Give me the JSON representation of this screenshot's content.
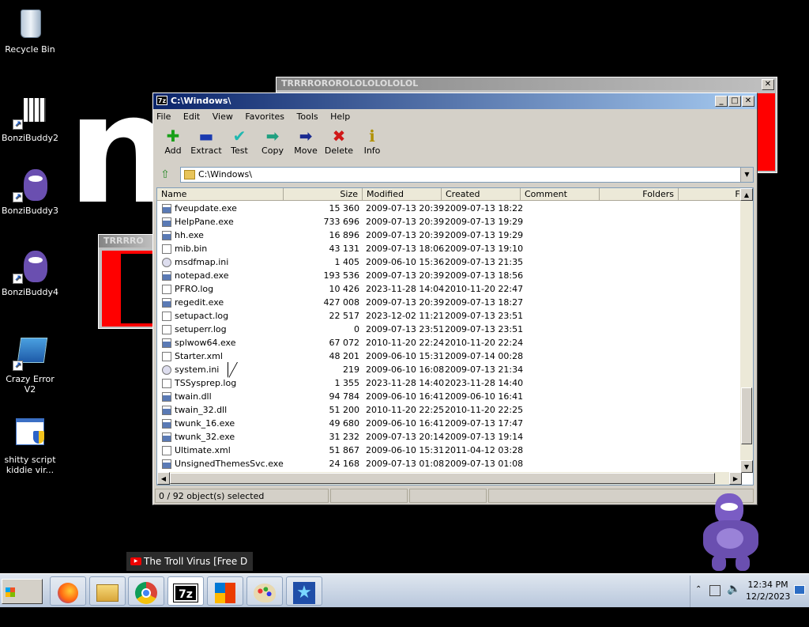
{
  "desktop": {
    "icons": [
      {
        "label": "Recycle Bin"
      },
      {
        "label": "BonziBuddy2"
      },
      {
        "label": "BonziBuddy3"
      },
      {
        "label": "BonziBuddy4"
      },
      {
        "label": "Crazy Error V2"
      },
      {
        "label": "shitty script kiddie vir..."
      }
    ],
    "big_letter": "n"
  },
  "bg_window_1": {
    "title": "TRRRROROROLOLOLOLOLOL"
  },
  "bg_window_2": {
    "title": "TRRRRO"
  },
  "window": {
    "title": "C:\\Windows\\",
    "menu": [
      "File",
      "Edit",
      "View",
      "Favorites",
      "Tools",
      "Help"
    ],
    "toolbar": [
      {
        "label": "Add",
        "icon": "plus-icon",
        "glyph": "✚",
        "color": "#18a018"
      },
      {
        "label": "Extract",
        "icon": "minus-icon",
        "glyph": "▬",
        "color": "#1a3ab0"
      },
      {
        "label": "Test",
        "icon": "check-icon",
        "glyph": "✔",
        "color": "#20b8b0"
      },
      {
        "label": "Copy",
        "icon": "arrow-right-icon",
        "glyph": "➡",
        "color": "#20a080"
      },
      {
        "label": "Move",
        "icon": "arrow-right-icon",
        "glyph": "➡",
        "color": "#1a2a90"
      },
      {
        "label": "Delete",
        "icon": "x-icon",
        "glyph": "✖",
        "color": "#d01818"
      },
      {
        "label": "Info",
        "icon": "info-icon",
        "glyph": "ℹ",
        "color": "#b09000"
      }
    ],
    "address": "C:\\Windows\\",
    "columns": [
      "Name",
      "Size",
      "Modified",
      "Created",
      "Comment",
      "Folders",
      "Fi"
    ],
    "rows": [
      {
        "name": "fveupdate.exe",
        "size": "15 360",
        "modified": "2009-07-13 20:39",
        "created": "2009-07-13 18:22",
        "type": "exe"
      },
      {
        "name": "HelpPane.exe",
        "size": "733 696",
        "modified": "2009-07-13 20:39",
        "created": "2009-07-13 19:29",
        "type": "exe"
      },
      {
        "name": "hh.exe",
        "size": "16 896",
        "modified": "2009-07-13 20:39",
        "created": "2009-07-13 19:29",
        "type": "exe"
      },
      {
        "name": "mib.bin",
        "size": "43 131",
        "modified": "2009-07-13 18:06",
        "created": "2009-07-13 19:10",
        "type": "file"
      },
      {
        "name": "msdfmap.ini",
        "size": "1 405",
        "modified": "2009-06-10 15:36",
        "created": "2009-07-13 21:35",
        "type": "ini"
      },
      {
        "name": "notepad.exe",
        "size": "193 536",
        "modified": "2009-07-13 20:39",
        "created": "2009-07-13 18:56",
        "type": "exe"
      },
      {
        "name": "PFRO.log",
        "size": "10 426",
        "modified": "2023-11-28 14:04",
        "created": "2010-11-20 22:47",
        "type": "file"
      },
      {
        "name": "regedit.exe",
        "size": "427 008",
        "modified": "2009-07-13 20:39",
        "created": "2009-07-13 18:27",
        "type": "exe"
      },
      {
        "name": "setupact.log",
        "size": "22 517",
        "modified": "2023-12-02 11:21",
        "created": "2009-07-13 23:51",
        "type": "file"
      },
      {
        "name": "setuperr.log",
        "size": "0",
        "modified": "2009-07-13 23:51",
        "created": "2009-07-13 23:51",
        "type": "file"
      },
      {
        "name": "splwow64.exe",
        "size": "67 072",
        "modified": "2010-11-20 22:24",
        "created": "2010-11-20 22:24",
        "type": "exe"
      },
      {
        "name": "Starter.xml",
        "size": "48 201",
        "modified": "2009-06-10 15:31",
        "created": "2009-07-14 00:28",
        "type": "file"
      },
      {
        "name": "system.ini",
        "size": "219",
        "modified": "2009-06-10 16:08",
        "created": "2009-07-13 21:34",
        "type": "ini"
      },
      {
        "name": "TSSysprep.log",
        "size": "1 355",
        "modified": "2023-11-28 14:40",
        "created": "2023-11-28 14:40",
        "type": "file"
      },
      {
        "name": "twain.dll",
        "size": "94 784",
        "modified": "2009-06-10 16:41",
        "created": "2009-06-10 16:41",
        "type": "exe"
      },
      {
        "name": "twain_32.dll",
        "size": "51 200",
        "modified": "2010-11-20 22:25",
        "created": "2010-11-20 22:25",
        "type": "exe"
      },
      {
        "name": "twunk_16.exe",
        "size": "49 680",
        "modified": "2009-06-10 16:41",
        "created": "2009-07-13 17:47",
        "type": "exe"
      },
      {
        "name": "twunk_32.exe",
        "size": "31 232",
        "modified": "2009-07-13 20:14",
        "created": "2009-07-13 19:14",
        "type": "exe"
      },
      {
        "name": "Ultimate.xml",
        "size": "51 867",
        "modified": "2009-06-10 15:31",
        "created": "2011-04-12 03:28",
        "type": "file"
      },
      {
        "name": "UnsignedThemesSvc.exe",
        "size": "24 168",
        "modified": "2009-07-13 01:08",
        "created": "2009-07-13 01:08",
        "type": "exe"
      }
    ],
    "status": "0 / 92 object(s) selected"
  },
  "tooltip": "The Troll Virus [Free D",
  "taskbar": {
    "start": "Start",
    "items": [
      "firefox-icon",
      "file-explorer-icon",
      "chrome-icon",
      "7zip-icon",
      "office-icon",
      "paint-icon",
      "star-app-icon"
    ],
    "time": "12:34 PM",
    "date": "12/2/2023"
  }
}
